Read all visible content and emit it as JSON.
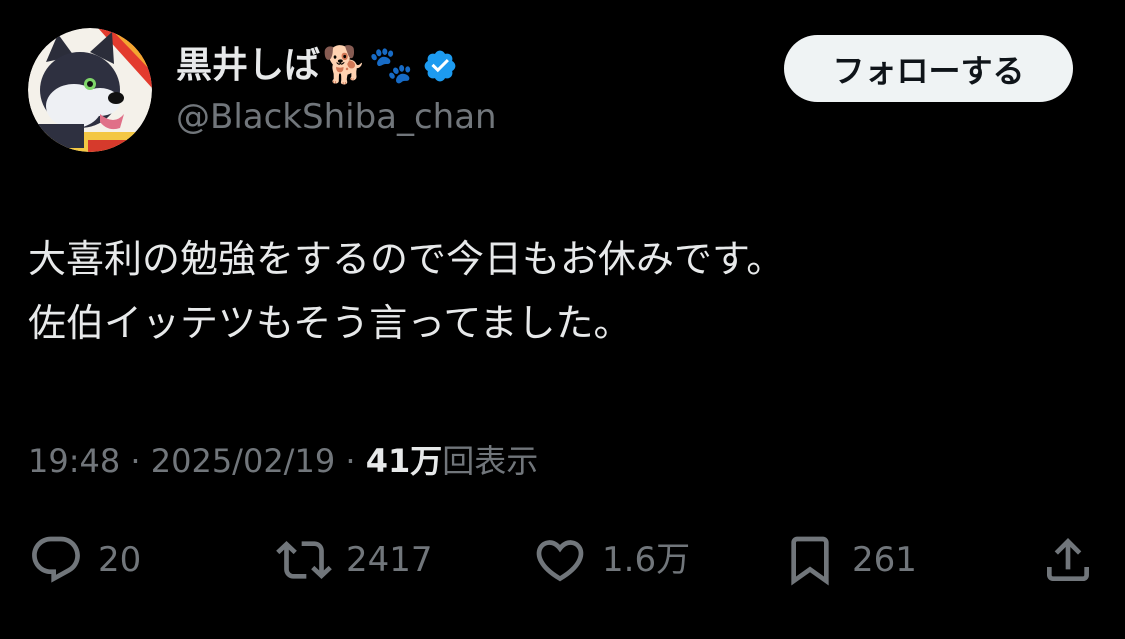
{
  "user": {
    "display_name": "黒井しば",
    "name_emojis": [
      "🐕",
      "🐾"
    ],
    "verified": true,
    "handle": "@BlackShiba_chan"
  },
  "follow_button": {
    "label": "フォローする"
  },
  "tweet": {
    "lines": [
      "大喜利の勉強をするので今日もお休みです。",
      "佐伯イッテツもそう言ってました。"
    ]
  },
  "meta": {
    "time": "19:48",
    "separator1": " · ",
    "date": "2025/02/19",
    "separator2": " · ",
    "views_count": "41万",
    "views_label": "回表示"
  },
  "actions": {
    "reply_count": "20",
    "retweet_count": "2417",
    "like_count": "1.6万",
    "bookmark_count": "261"
  },
  "colors": {
    "background": "#000000",
    "primary_text": "#e7e9ea",
    "secondary_text": "#71767b",
    "verified_blue": "#1d9bf0",
    "follow_bg": "#eff3f4"
  },
  "icons": {
    "reply": "reply-icon",
    "retweet": "retweet-icon",
    "like": "heart-icon",
    "bookmark": "bookmark-icon",
    "share": "share-icon",
    "verified": "verified-badge-icon"
  }
}
